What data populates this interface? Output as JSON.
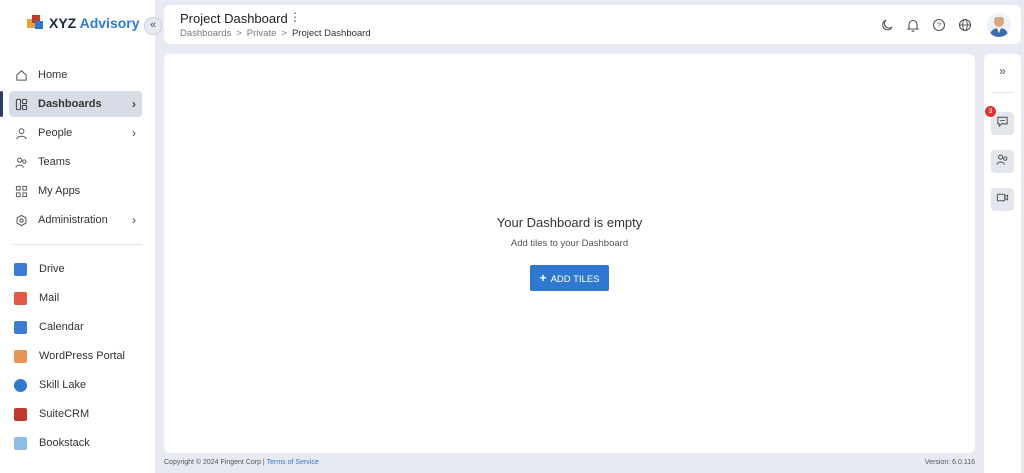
{
  "app": {
    "name_prefix": "XYZ",
    "name_suffix": "Advisory"
  },
  "sidebar": {
    "collapse_icon": "«",
    "nav": [
      {
        "label": "Home",
        "icon": "home-icon"
      },
      {
        "label": "Dashboards",
        "icon": "dashboard-icon",
        "active": true
      },
      {
        "label": "People",
        "icon": "person-icon"
      },
      {
        "label": "Teams",
        "icon": "teams-icon"
      },
      {
        "label": "My Apps",
        "icon": "apps-grid-icon"
      },
      {
        "label": "Administration",
        "icon": "gear-icon"
      }
    ],
    "apps": [
      {
        "label": "Drive",
        "icon": "drive-icon",
        "color": "#3b7bd4"
      },
      {
        "label": "Mail",
        "icon": "mail-icon",
        "color": "#e05a47"
      },
      {
        "label": "Calendar",
        "icon": "calendar-icon",
        "color": "#3b7bd4"
      },
      {
        "label": "WordPress Portal",
        "icon": "wordpress-portal-icon",
        "color": "#e8955a"
      },
      {
        "label": "Skill Lake",
        "icon": "skill-lake-icon",
        "color": "#2f78d0"
      },
      {
        "label": "SuiteCRM",
        "icon": "suitecrm-icon",
        "color": "#c0392b"
      },
      {
        "label": "Bookstack",
        "icon": "bookstack-icon",
        "color": "#8fbde6"
      }
    ]
  },
  "header": {
    "title": "Project Dashboard",
    "menu_icon": "⋮",
    "breadcrumb": [
      "Dashboards",
      "Private",
      "Project Dashboard"
    ],
    "separator": ">"
  },
  "main": {
    "empty_title": "Your Dashboard is empty",
    "empty_subtitle": "Add tiles to your Dashboard",
    "add_button": "ADD TILES",
    "add_button_plus": "+"
  },
  "footer": {
    "copyright": "Copyright © 2024 Fingent Corp |",
    "terms": "Terms of Service",
    "version": "Version: 6.0.116"
  },
  "rail": {
    "expand_icon": "»",
    "chat_badge": "3"
  },
  "colors": {
    "accent": "#2f78d0",
    "badge": "#e03030",
    "brand_dark": "#1a2a4a"
  }
}
